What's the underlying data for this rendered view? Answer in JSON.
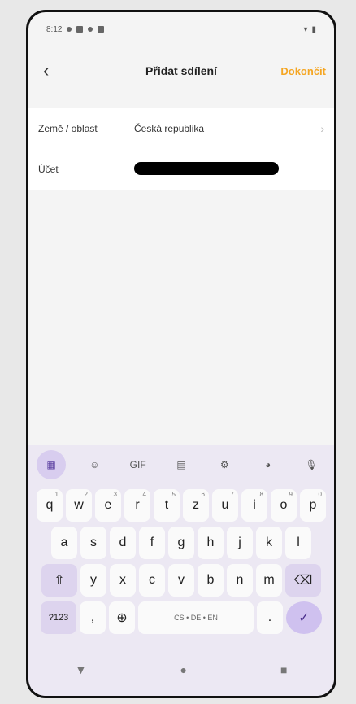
{
  "status": {
    "time": "8:12"
  },
  "header": {
    "title": "Přidat sdílení",
    "done": "Dokončit"
  },
  "form": {
    "region_label": "Země / oblast",
    "region_value": "Česká republika",
    "account_label": "Účet"
  },
  "keyboard": {
    "row1": [
      "q",
      "w",
      "e",
      "r",
      "t",
      "z",
      "u",
      "i",
      "o",
      "p"
    ],
    "row1_sup": [
      "1",
      "2",
      "3",
      "4",
      "5",
      "6",
      "7",
      "8",
      "9",
      "0"
    ],
    "row2": [
      "a",
      "s",
      "d",
      "f",
      "g",
      "h",
      "j",
      "k",
      "l"
    ],
    "row3": [
      "y",
      "x",
      "c",
      "v",
      "b",
      "n",
      "m"
    ],
    "sym_key": "?123",
    "space_label": "CS • DE • EN",
    "gif": "GIF"
  },
  "icons": [
    "back-icon",
    "chevron-right-icon",
    "apps-icon",
    "sticker-icon",
    "clipboard-icon",
    "gear-icon",
    "palette-icon",
    "mic-icon",
    "shift-icon",
    "backspace-icon",
    "globe-icon",
    "check-icon",
    "nav-back-icon",
    "nav-home-icon",
    "nav-recents-icon"
  ]
}
